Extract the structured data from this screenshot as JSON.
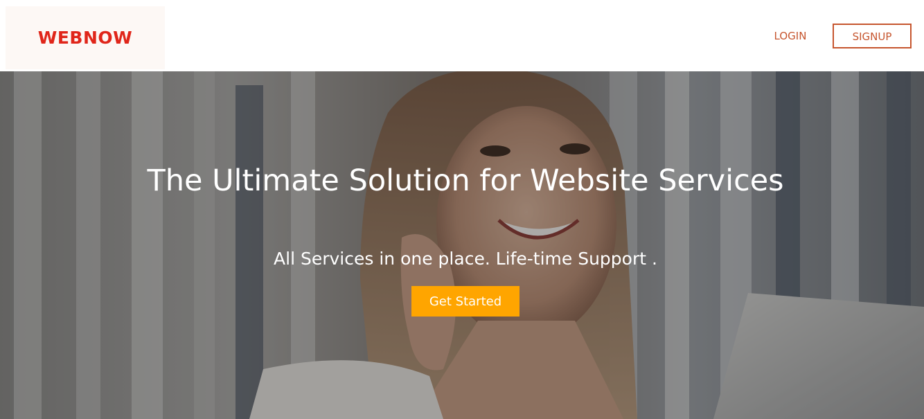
{
  "brand": {
    "name": "WEBNOW",
    "color": "#e0261a",
    "box_color": "#fdf8f5"
  },
  "nav": {
    "login_label": "LOGIN",
    "signup_label": "SIGNUP",
    "accent_color": "#c6552e"
  },
  "hero": {
    "title": "The Ultimate Solution for Website Services",
    "subtitle": "All Services in one place. Life-time Support .",
    "cta_label": "Get Started",
    "cta_color": "#ffa500"
  }
}
